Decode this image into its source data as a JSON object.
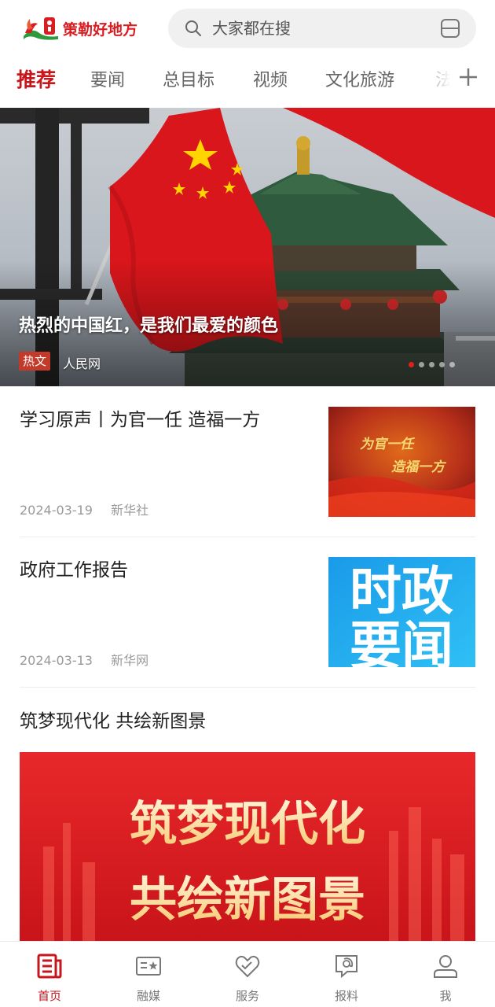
{
  "header": {
    "logo_text": "策勒好地方",
    "search_placeholder": "大家都在搜",
    "search_icon": "search-icon",
    "scan_icon": "scan-icon"
  },
  "tabs": [
    {
      "label": "推荐",
      "active": true
    },
    {
      "label": "要闻",
      "active": false
    },
    {
      "label": "总目标",
      "active": false
    },
    {
      "label": "视频",
      "active": false
    },
    {
      "label": "文化旅游",
      "active": false
    },
    {
      "label": "法",
      "active": false
    }
  ],
  "tab_add_icon": "plus-icon",
  "hero": {
    "title": "热烈的中国红，是我们最爱的颜色",
    "tag": "热文",
    "source": "人民网",
    "slide_count": 5,
    "active_slide": 1
  },
  "news": [
    {
      "title": "学习原声丨为官一任 造福一方",
      "date": "2024-03-19",
      "source": "新华社",
      "thumb_text": [
        "为官一任",
        "造福一方"
      ]
    },
    {
      "title": "政府工作报告",
      "date": "2024-03-13",
      "source": "新华网",
      "thumb_text": [
        "时政",
        "要闻"
      ]
    },
    {
      "title": "筑梦现代化 共绘新图景",
      "banner_text": [
        "筑梦现代化",
        "共绘新图景"
      ]
    }
  ],
  "bottom_nav": [
    {
      "label": "首页",
      "icon": "news-icon",
      "active": true
    },
    {
      "label": "融媒",
      "icon": "media-card-icon",
      "active": false
    },
    {
      "label": "服务",
      "icon": "heart-service-icon",
      "active": false
    },
    {
      "label": "报料",
      "icon": "report-chat-icon",
      "active": false
    },
    {
      "label": "我",
      "icon": "user-icon",
      "active": false
    }
  ],
  "colors": {
    "accent": "#c8161d",
    "tag_bg": "#c23a2a"
  }
}
